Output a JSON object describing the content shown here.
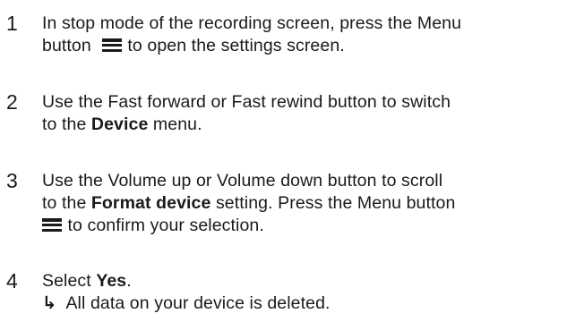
{
  "steps": [
    {
      "number": "1",
      "line1": "In stop mode of the recording screen, press the Menu",
      "line2_pre": "button",
      "line2_post": "to open the settings screen.",
      "icon": "menu-icon"
    },
    {
      "number": "2",
      "line1": "Use the Fast forward or Fast rewind button to switch",
      "line2_pre": "to the ",
      "line2_bold": "Device",
      "line2_post": " menu."
    },
    {
      "number": "3",
      "line1": "Use the Volume up or Volume down button to scroll",
      "line2_pre": "to the ",
      "line2_bold": "Format device",
      "line2_post": " setting. Press the Menu button",
      "line3_post": "to confirm your selection.",
      "icon": "menu-icon"
    },
    {
      "number": "4",
      "line1_pre": "Select ",
      "line1_bold": "Yes",
      "line1_post": ".",
      "result_arrow": "↳",
      "result_text": "All data on your device is deleted."
    }
  ]
}
